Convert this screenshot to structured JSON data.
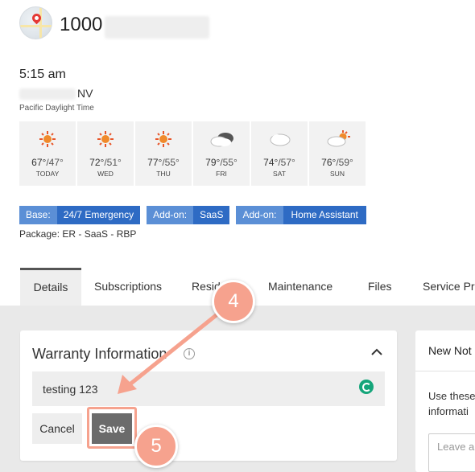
{
  "location": {
    "address_prefix": "1000",
    "time": "5:15 am",
    "state": "NV",
    "timezone": "Pacific Daylight Time"
  },
  "weather": [
    {
      "icon": "sun-icon",
      "high": "67°",
      "low": "/47°",
      "day": "TODAY"
    },
    {
      "icon": "sun-icon",
      "high": "72°",
      "low": "/51°",
      "day": "WED"
    },
    {
      "icon": "sun-icon",
      "high": "77°",
      "low": "/55°",
      "day": "THU"
    },
    {
      "icon": "cloudy-icon",
      "high": "79°",
      "low": "/55°",
      "day": "FRI"
    },
    {
      "icon": "cloud-icon",
      "high": "74°",
      "low": "/57°",
      "day": "SAT"
    },
    {
      "icon": "partly-sunny-icon",
      "high": "76°",
      "low": "/59°",
      "day": "SUN"
    }
  ],
  "badges": [
    {
      "key": "Base:",
      "value": "24/7 Emergency"
    },
    {
      "key": "Add-on:",
      "value": "SaaS"
    },
    {
      "key": "Add-on:",
      "value": "Home Assistant"
    }
  ],
  "package": "Package: ER - SaaS - RBP",
  "tabs": [
    {
      "label": "Details"
    },
    {
      "label": "Subscriptions"
    },
    {
      "label": "Resid"
    },
    {
      "label": "Maintenance"
    },
    {
      "label": "Files"
    },
    {
      "label": "Service Pr"
    }
  ],
  "warranty": {
    "title": "Warranty Information",
    "value": "testing 123",
    "cancel_label": "Cancel",
    "save_label": "Save"
  },
  "notes": {
    "title": "New Not",
    "body_line1": "Use these",
    "body_line2": "informati",
    "placeholder": "Leave a"
  },
  "steps": {
    "step4": "4",
    "step5": "5"
  },
  "colors": {
    "accent_blue": "#2e6bc4",
    "badge_key_blue": "#5b8fd6",
    "step_coral": "#f6a28e",
    "save_grey": "#6b6b6b"
  }
}
